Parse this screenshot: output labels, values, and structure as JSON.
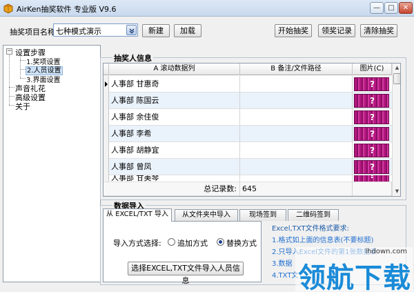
{
  "window": {
    "title": "AirKen抽奖软件 专业版 V9.6"
  },
  "toolbar": {
    "project_label": "抽奖项目名称",
    "project_value": "七种模式演示",
    "new_label": "新建",
    "load_label": "加载",
    "start_label": "开始抽奖",
    "record_label": "领奖记录",
    "clear_label": "清除抽奖"
  },
  "tree": {
    "root": "设置步骤",
    "children": [
      "1.奖项设置",
      "2.人员设置",
      "3.界面设置"
    ],
    "items": [
      "声音礼花",
      "高级设置",
      "关于"
    ],
    "selected": "2.人员设置"
  },
  "info_group": {
    "title": "抽奖人信息",
    "columns": [
      "A 滚动数据列",
      "B 备注/文件路径",
      "图片(C)"
    ],
    "rows": [
      {
        "a": "人事部 甘惠奇",
        "b": ""
      },
      {
        "a": "人事部 陈国云",
        "b": ""
      },
      {
        "a": "人事部 余佳俊",
        "b": ""
      },
      {
        "a": "人事部 李希",
        "b": ""
      },
      {
        "a": "人事部 胡静宜",
        "b": ""
      },
      {
        "a": "人事部 曾凤",
        "b": ""
      },
      {
        "a": "人事部 甘美琴",
        "b": ""
      }
    ],
    "pic_glyph": "?",
    "total_label": "总记录数:",
    "total_value": "645"
  },
  "import_group": {
    "title": "数据导入",
    "tabs": [
      "从 EXCEL/TXT 导入",
      "从文件夹中导入",
      "现场签到",
      "二维码签到"
    ],
    "active_tab": "从 EXCEL/TXT 导入",
    "mode_label": "导入方式选择:",
    "mode_options": [
      "追加方式",
      "替换方式"
    ],
    "mode_selected": "替换方式",
    "import_button": "选择EXCEL,TXT文件导入人员信息",
    "help": [
      "Excel,TXT文件格式要求:",
      "1.格式如上面的信息表(不要标题)",
      "2.只导入Excel文件的第1张数据表",
      "3.数据",
      "4.TXT文"
    ]
  },
  "watermark": {
    "text": "领航下载",
    "site": "lhdown.com"
  },
  "colors": {
    "accent": "#1f6fd1",
    "picture": "#b3167f",
    "selection": "#cfe3f7"
  }
}
